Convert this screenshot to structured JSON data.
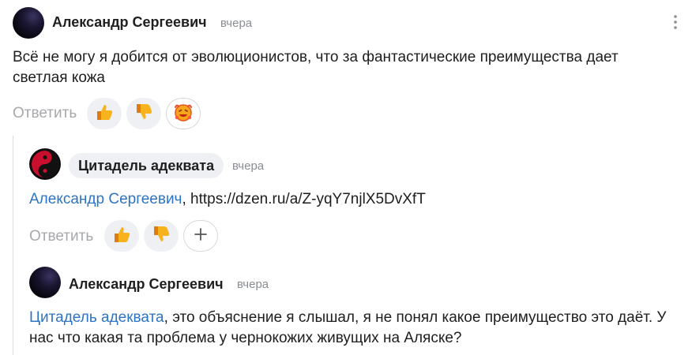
{
  "comment1": {
    "author": "Александр Сергеевич",
    "time": "вчера",
    "text": "Всё не могу я добится от эволюционистов, что за фантастические преимущества дает светлая кожа",
    "reply_label": "Ответить",
    "icons": [
      "thumbs-up-icon",
      "thumbs-down-icon",
      "laughing-emoji-icon",
      "more-vertical-icon"
    ]
  },
  "comment2": {
    "author": "Цитадель адеквата",
    "time": "вчера",
    "mention": "Александр Сергеевич",
    "text": ", https://dzen.ru/a/Z-yqY7njlX5DvXfT",
    "reply_label": "Ответить",
    "icons": [
      "thumbs-up-icon",
      "thumbs-down-icon",
      "add-reaction-icon"
    ]
  },
  "comment3": {
    "author": "Александр Сергеевич",
    "time": "вчера",
    "mention": "Цитадель адеквата",
    "text": ", это объяснение я слышал, я не понял какое преимущество это даёт. У нас что какая та проблема у чернокожих живущих на Аляске?"
  },
  "colors": {
    "link": "#2d74c4",
    "muted": "#a6a8ab",
    "chip": "#eef0f3"
  }
}
